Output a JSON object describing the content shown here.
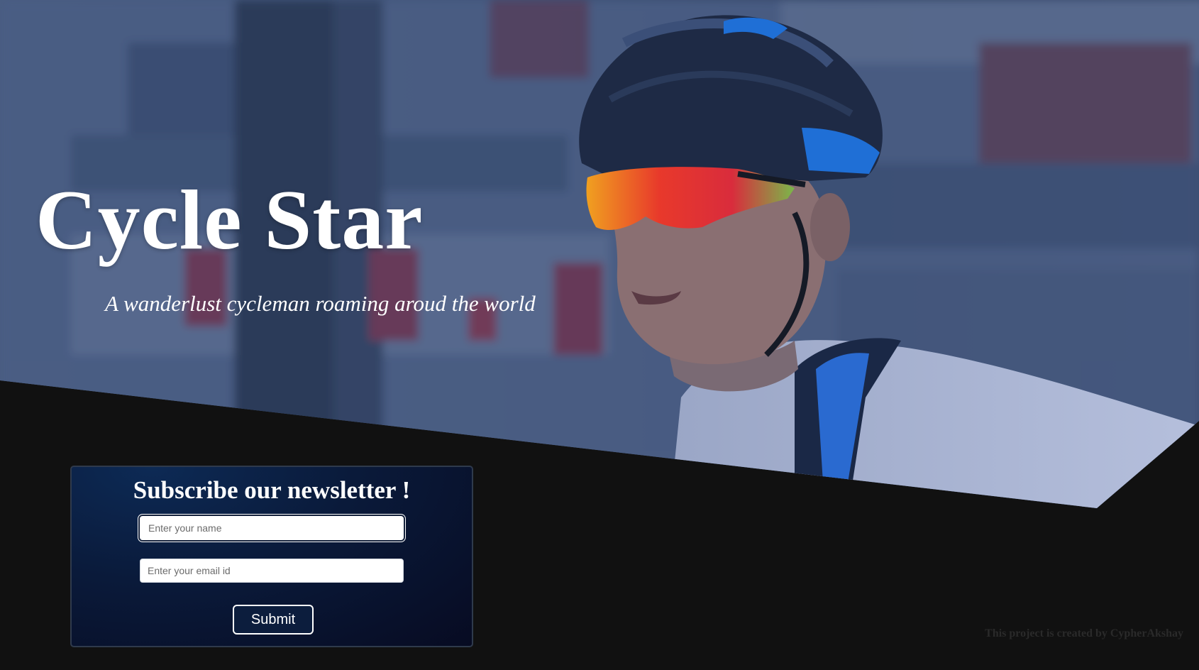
{
  "hero": {
    "title": "Cycle Star",
    "subtitle": "A wanderlust cycleman roaming aroud the world",
    "image_subject": "cyclist in helmet and mirrored sunglasses"
  },
  "newsletter": {
    "heading": "Subscribe our newsletter !",
    "name_placeholder": "Enter your name",
    "email_placeholder": "Enter your email id",
    "submit_label": "Submit"
  },
  "footer": {
    "credit": "This project is created by CypherAkshay"
  },
  "colors": {
    "background": "#111111",
    "card": "#0a1a3a",
    "helmet_accent": "#1f6fd6",
    "lens": "#e83a2c"
  }
}
